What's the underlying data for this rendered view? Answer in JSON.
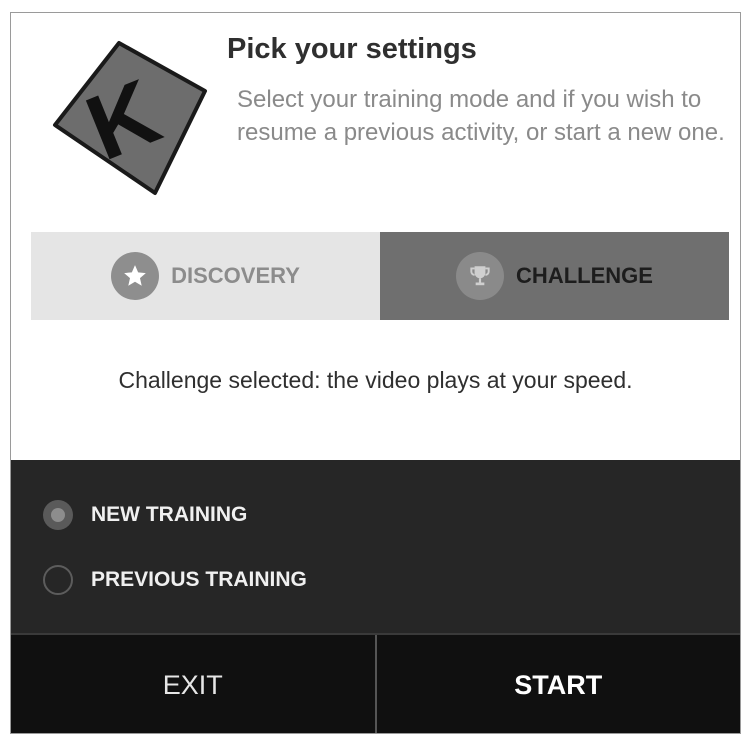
{
  "header": {
    "title": "Pick your settings",
    "subtitle": "Select your training mode and if you wish to resume a previous activity, or start a new one.",
    "logo_letter": "K"
  },
  "modes": {
    "selected": "challenge",
    "discovery": {
      "label": "DISCOVERY",
      "icon": "star-icon"
    },
    "challenge": {
      "label": "CHALLENGE",
      "icon": "trophy-icon"
    }
  },
  "status_text": "Challenge selected: the video plays at your speed.",
  "training": {
    "selected": "new",
    "options": [
      {
        "id": "new",
        "label": "NEW TRAINING"
      },
      {
        "id": "previous",
        "label": "PREVIOUS TRAINING"
      }
    ]
  },
  "actions": {
    "exit_label": "EXIT",
    "start_label": "START"
  },
  "colors": {
    "selected_tab": "#6f6f6f",
    "unselected_tab": "#e5e5e5",
    "panel": "#262626",
    "buttons": "#101010"
  }
}
